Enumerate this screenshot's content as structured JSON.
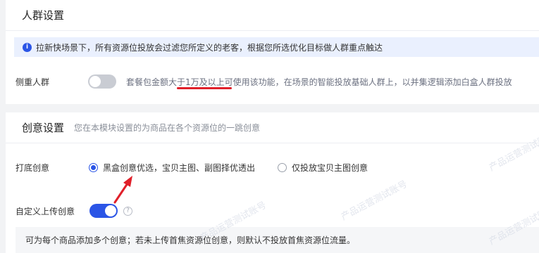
{
  "crowd_section": {
    "title": "人群设置",
    "notice": "拉新快场景下，所有资源位投放会过滤您所定义的老客，根据您所选优化目标做人群重点触达",
    "focus_crowd": {
      "label": "侧重人群",
      "enabled": false,
      "description": "套餐包金额大于1万及以上可使用该功能，在场景的智能投放基础人群上，以并集逻辑添加白盒人群投放"
    }
  },
  "creative_section": {
    "title": "创意设置",
    "subtitle": "您在本模块设置的为商品在各个资源位的一跳创意",
    "fallback": {
      "label": "打底创意",
      "options": [
        {
          "label": "黑盒创意优选，宝贝主图、副图择优透出",
          "checked": true
        },
        {
          "label": "仅投放宝贝主图创意",
          "checked": false
        }
      ]
    },
    "custom_upload": {
      "label": "自定义上传创意",
      "enabled": true,
      "help": "?"
    },
    "note": "可为每个商品添加多个创意；若未上传首焦资源位创意，则默认不投放首焦资源位流量。"
  },
  "watermark_text": "产品运营测试账号",
  "colors": {
    "accent": "#2b55e6",
    "annotation": "#e0202a",
    "page_bg": "#f2f3f5"
  }
}
